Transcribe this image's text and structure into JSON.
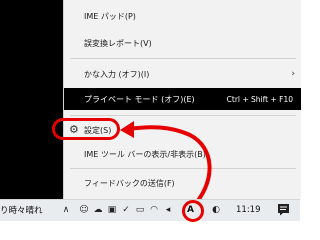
{
  "menu": {
    "items": [
      {
        "label": "IME パッド(P)"
      },
      {
        "label": "誤変換レポート(V)"
      },
      {
        "label": "かな入力 (オフ)(I)"
      },
      {
        "label": "プライベート モード (オフ)(E)",
        "shortcut": "Ctrl + Shift + F10"
      },
      {
        "label": "設定(S)"
      },
      {
        "label": "IME ツール バーの表示/非表示(B)"
      },
      {
        "label": "フィードバックの送信(F)"
      }
    ]
  },
  "taskbar": {
    "weather_text": "り時々晴れ",
    "ime_indicator": "A",
    "clock": "11:19"
  },
  "colors": {
    "annotation": "#e60000",
    "highlight_bg": "#000000"
  }
}
